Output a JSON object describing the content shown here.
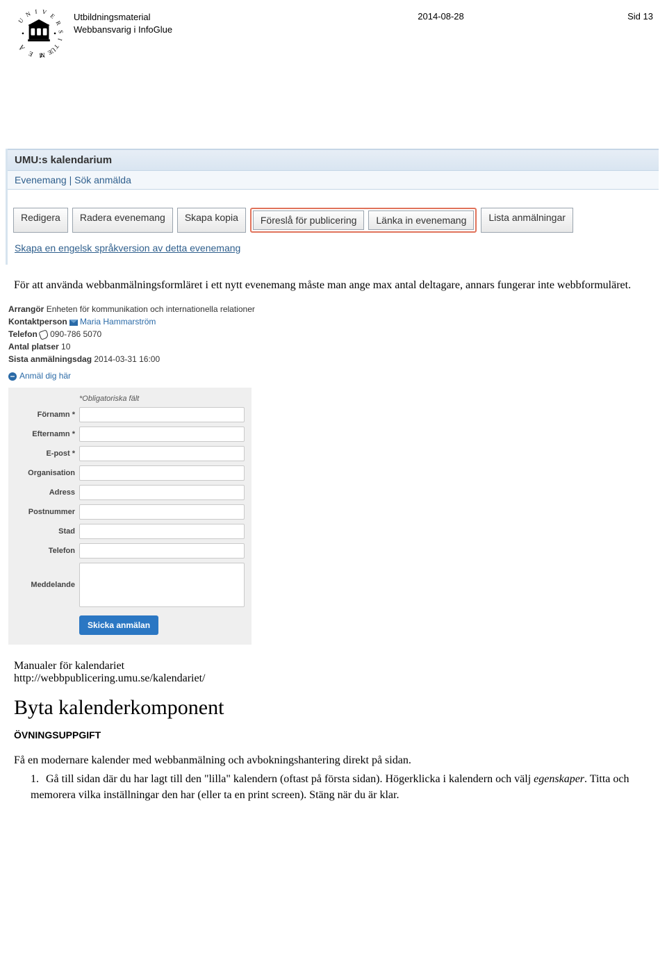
{
  "header": {
    "title_line1": "Utbildningsmaterial",
    "title_line2": "Webbansvarig i InfoGlue",
    "date": "2014-08-28",
    "page": "Sid 13"
  },
  "kal": {
    "title": "UMU:s kalendarium",
    "subnav": "Evenemang | Sök anmälda",
    "buttons": {
      "edit": "Redigera",
      "delete": "Radera evenemang",
      "copy": "Skapa kopia",
      "propose": "Föreslå för publicering",
      "linkin": "Länka in evenemang",
      "list": "Lista anmälningar"
    },
    "lang_link": "Skapa en engelsk språkversion av detta evenemang"
  },
  "para1": "För att använda webbanmälningsformläret i ett nytt evenemang måste man ange max antal deltagare, annars fungerar inte webbformuläret.",
  "formshot": {
    "org_label": "Arrangör",
    "org_value": "Enheten för kommunikation och internationella relationer",
    "contact_label": "Kontaktperson",
    "contact_value": "Maria Hammarström",
    "phone_label": "Telefon",
    "phone_value": "090-786 5070",
    "seats_label": "Antal platser",
    "seats_value": "10",
    "deadline_label": "Sista anmälningsdag",
    "deadline_value": "2014-03-31 16:00",
    "signup_link": "Anmäl dig här",
    "oblig": "*Obligatoriska fält",
    "fields": {
      "fornamn": "Förnamn *",
      "efternamn": "Efternamn *",
      "epost": "E-post *",
      "organisation": "Organisation",
      "adress": "Adress",
      "postnummer": "Postnummer",
      "stad": "Stad",
      "telefon": "Telefon",
      "meddelande": "Meddelande"
    },
    "submit": "Skicka anmälan"
  },
  "manuals_line1": "Manualer för kalendariet",
  "manuals_line2": "http://webbpublicering.umu.se/kalendariet/",
  "h1": "Byta kalenderkomponent",
  "exercise_label": "ÖVNINGSUPPGIFT",
  "exercise_intro": "Få en modernare kalender med webbanmälning och avbokningshantering direkt på sidan.",
  "step1_a": "Gå till sidan där du har lagt till den \"lilla\" kalendern (oftast på första sidan). Högerklicka i kalendern och välj ",
  "step1_em": "egenskaper",
  "step1_b": ". Titta och memorera vilka inställningar den har (eller ta en print screen). Stäng när du är klar."
}
